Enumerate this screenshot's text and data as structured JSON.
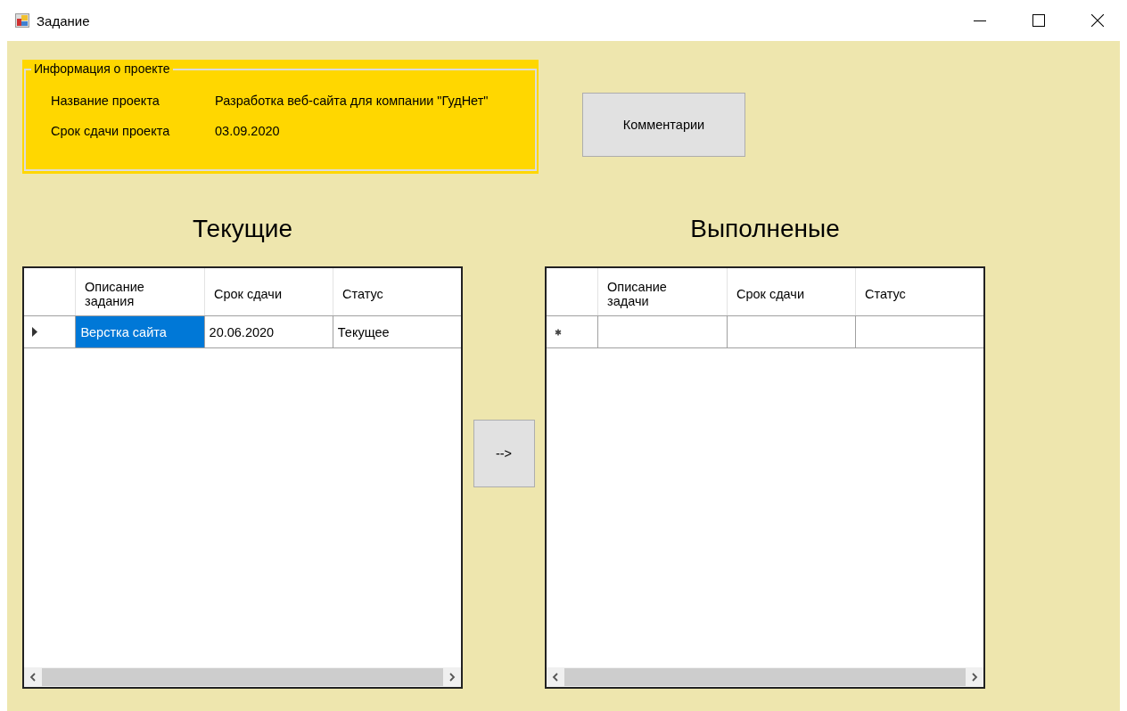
{
  "window": {
    "title": "Задание"
  },
  "project_info": {
    "legend": "Информация о проекте",
    "fields": [
      {
        "label": "Название проекта",
        "value": "Разработка веб-сайта для компании \"ГудНет\""
      },
      {
        "label": "Срок сдачи проекта",
        "value": "03.09.2020"
      }
    ]
  },
  "comments_button": "Комментарии",
  "move_button": "-->",
  "grids": [
    {
      "heading": "Текущие",
      "columns": [
        "Описание задания",
        "Срок сдачи",
        "Статус"
      ],
      "rows": [
        {
          "kind": "data",
          "current": true,
          "cells": [
            {
              "text": "Верстка сайта",
              "selected": true
            },
            {
              "text": "20.06.2020",
              "selected": false
            },
            {
              "text": "Текущее",
              "selected": false
            }
          ]
        }
      ]
    },
    {
      "heading": "Выполненые",
      "columns": [
        "Описание задачи",
        "Срок сдачи",
        "Статус"
      ],
      "rows": [
        {
          "kind": "new",
          "current": false
        }
      ]
    }
  ]
}
